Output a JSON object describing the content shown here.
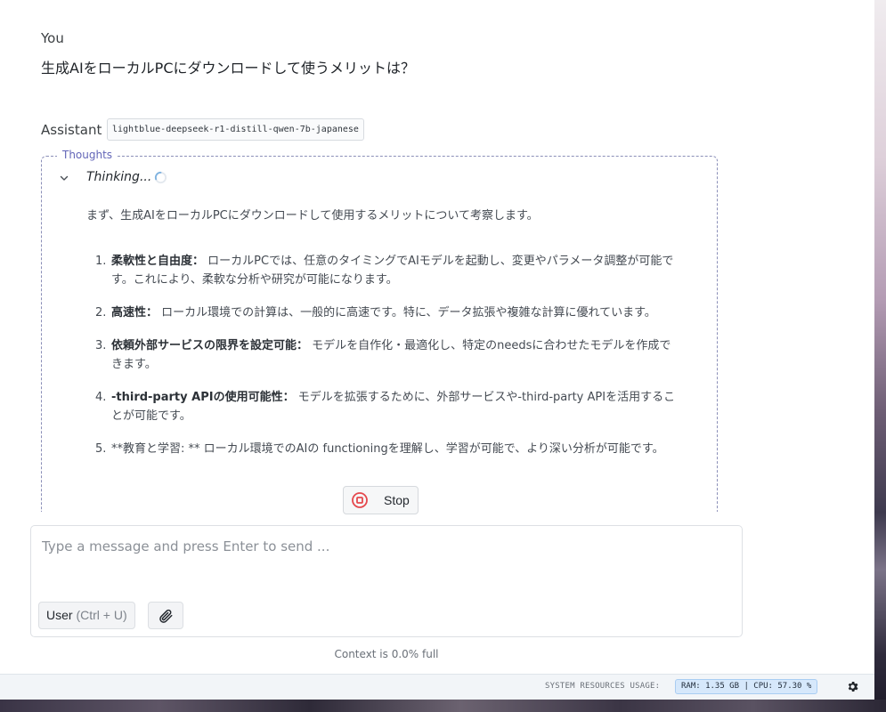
{
  "conversation": {
    "user": {
      "role": "You",
      "message": "生成AIをローカルPCにダウンロードして使うメリットは？"
    },
    "assistant": {
      "role": "Assistant",
      "model": "lightblue-deepseek-r1-distill-qwen-7b-japanese",
      "thoughts_legend": "Thoughts",
      "thinking_label": "Thinking...",
      "intro": "まず、生成AIをローカルPCにダウンロードして使用するメリットについて考察します。",
      "items": [
        {
          "num": "1.",
          "title": "柔軟性と自由度：",
          "body": " ローカルPCでは、任意のタイミングでAIモデルを起動し、変更やパラメータ調整が可能です。これにより、柔軟な分析や研究が可能になります。"
        },
        {
          "num": "2.",
          "title": "高速性：",
          "body": " ローカル環境での計算は、一般的に高速です。特に、データ拡張や複雑な計算に優れています。"
        },
        {
          "num": "3.",
          "title": "依頼外部サービスの限界を設定可能：",
          "body": " モデルを自作化・最適化し、特定のneedsに合わせたモデルを作成できます。"
        },
        {
          "num": "4.",
          "title": "-third-party APIの使用可能性：",
          "body": " モデルを拡張するために、外部サービスや-third-party APIを活用することが可能です。"
        },
        {
          "num": "5.",
          "title": "",
          "body": "**教育と学習: ** ローカル環境でのAIの functioningを理解し、学習が可能で、より深い分析が可能です。"
        }
      ]
    }
  },
  "controls": {
    "stop_label": "Stop",
    "input_placeholder": "Type a message and press Enter to send ...",
    "input_value": "",
    "role_button": "User",
    "role_hint": "(Ctrl + U)"
  },
  "context_status": "Context is 0.0% full",
  "status_bar": {
    "label": "SYSTEM RESOURCES USAGE:",
    "usage": "RAM: 1.35 GB | CPU: 57.30 %"
  },
  "colors": {
    "accent": "#6366b8",
    "stop_red": "#e5484d",
    "usage_pill": "#d6e8fb"
  },
  "icons": {
    "collapse": "chevron-down-icon",
    "spinner": "loading-spinner-icon",
    "stop": "stop-circle-icon",
    "attach": "paperclip-icon",
    "settings": "gear-icon"
  }
}
